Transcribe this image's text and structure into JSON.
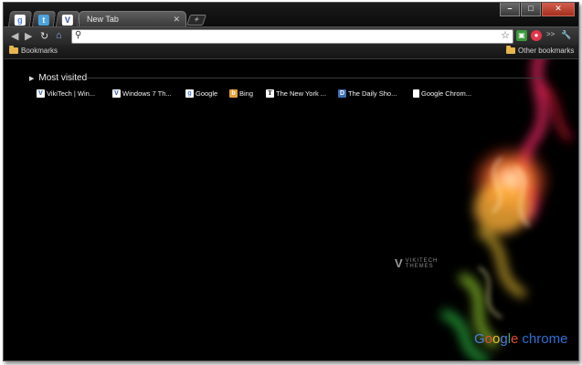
{
  "window": {
    "tab_title": "New Tab"
  },
  "tabs": [
    {
      "name": "google",
      "glyph": "g",
      "color": "#4a7fe8"
    },
    {
      "name": "twitter",
      "glyph": "t",
      "color": "#4aa3df"
    },
    {
      "name": "vikitech",
      "glyph": "V",
      "color": "#2b4fa6"
    }
  ],
  "toolbar": {
    "back": "◀",
    "forward": "▶",
    "reload": "↻",
    "home": "⌂",
    "omnibox_value": "",
    "star": "☆",
    "extensions_label": ">>",
    "wrench": "🔧"
  },
  "bookmarks_bar": {
    "left_label": "Bookmarks",
    "right_label": "Other bookmarks"
  },
  "most_visited": {
    "title": "Most visited",
    "items": [
      {
        "label": "VikiTech | Win...",
        "icon": "vikitech-icon",
        "color": "#2b4fa6"
      },
      {
        "label": "Windows 7 Th...",
        "icon": "vikitech-icon",
        "color": "#2b4fa6"
      },
      {
        "label": "Google",
        "icon": "google-icon",
        "color": "#4a7fe8"
      },
      {
        "label": "Bing",
        "icon": "bing-icon",
        "color": "#e8a23a"
      },
      {
        "label": "The New York ...",
        "icon": "nyt-icon",
        "color": "#ffffff"
      },
      {
        "label": "The Daily Sho...",
        "icon": "daily-show-icon",
        "color": "#3b6fb6"
      },
      {
        "label": "Google Chrom...",
        "icon": "page-icon",
        "color": "#ffffff"
      }
    ]
  },
  "watermark": {
    "mark": "V",
    "line1": "VIKITECH",
    "line2": "THEMES"
  },
  "brand": {
    "google": "Google",
    "chrome": "chrome"
  },
  "colors": {
    "background": "#000000",
    "text": "#f2f2f2",
    "folder": "#e7b64c"
  }
}
